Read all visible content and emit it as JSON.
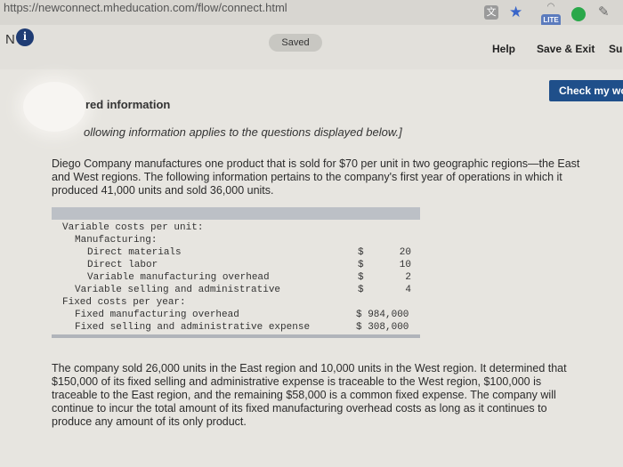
{
  "browser": {
    "url": "https://newconnect.mheducation.com/flow/connect.html",
    "lite_badge": "LITE"
  },
  "header": {
    "brand_letter": "N",
    "info_icon": "i",
    "saved_label": "Saved",
    "help_label": "Help",
    "save_exit_label": "Save & Exit",
    "submit_label": "Su",
    "check_label": "Check my wo"
  },
  "content": {
    "section_title": "red information",
    "intro": "ollowing information applies to the questions displayed below.]",
    "paragraph1": "Diego Company manufactures one product that is sold for $70 per unit in two geographic regions—the East and West regions. The following information pertains to the company's first year of operations in which it produced 41,000 units and sold 36,000 units.",
    "paragraph2": "The company sold 26,000 units in the East region and 10,000 units in the West region. It determined that $150,000 of its fixed selling and administrative expense is traceable to the West region, $100,000 is traceable to the East region, and the remaining $58,000 is a common fixed expense. The company will continue to incur the total amount of its fixed manufacturing overhead costs as long as it continues to produce any amount of its only product."
  },
  "cost_table": {
    "rows": [
      {
        "label": "Variable costs per unit:",
        "dollar": "",
        "amount": ""
      },
      {
        "label": "Manufacturing:",
        "dollar": "",
        "amount": ""
      },
      {
        "label": "Direct materials",
        "dollar": "$",
        "amount": "20"
      },
      {
        "label": "Direct labor",
        "dollar": "$",
        "amount": "10"
      },
      {
        "label": "Variable manufacturing overhead",
        "dollar": "$",
        "amount": "2"
      },
      {
        "label": "Variable selling and administrative",
        "dollar": "$",
        "amount": "4"
      },
      {
        "label": "Fixed costs per year:",
        "dollar": "",
        "amount": ""
      },
      {
        "label": "Fixed manufacturing overhead",
        "fixed": "$ 984,000"
      },
      {
        "label": "Fixed selling and administrative expense",
        "fixed": "$ 308,000"
      }
    ]
  },
  "colors": {
    "check_button": "#1f4f8a",
    "info_icon": "#1f3c74"
  }
}
